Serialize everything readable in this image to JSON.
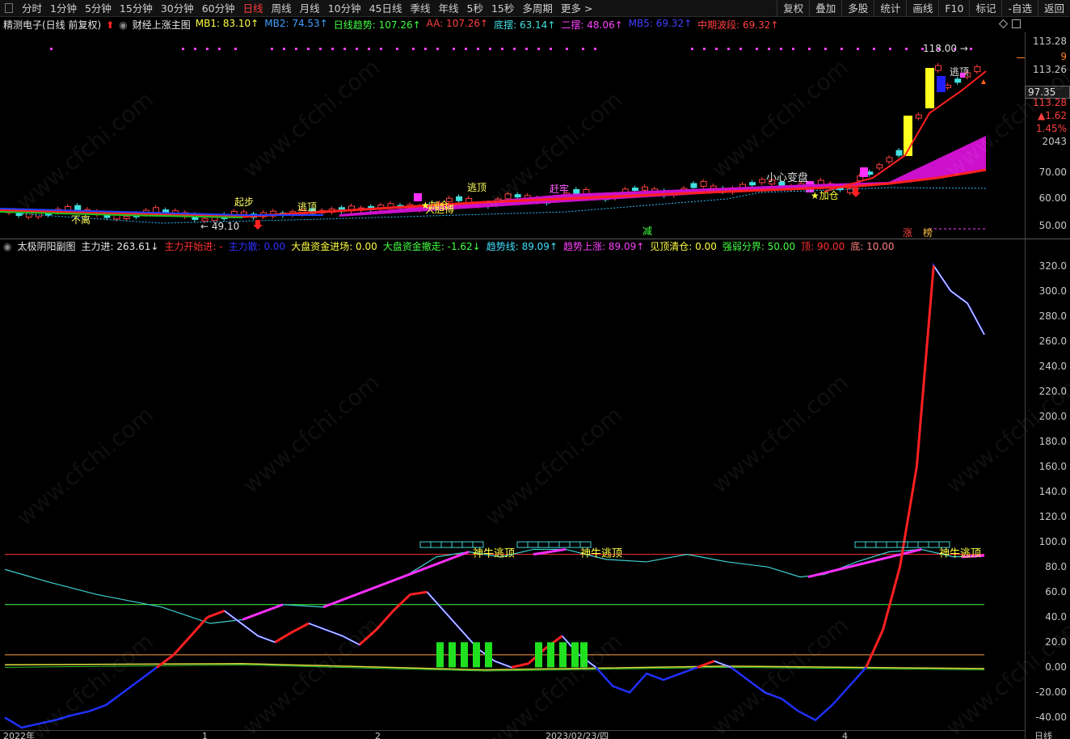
{
  "toolbar": {
    "items": [
      "分时",
      "1分钟",
      "5分钟",
      "15分钟",
      "30分钟",
      "60分钟",
      "日线",
      "周线",
      "月线",
      "10分钟",
      "45日线",
      "季线",
      "年线",
      "5秒",
      "15秒",
      "多周期",
      "更多 >"
    ],
    "active": "日线",
    "right_items": [
      "复权",
      "叠加",
      "多股",
      "统计",
      "画线",
      "F10",
      "标记",
      "-自选",
      "返回"
    ]
  },
  "main_header": {
    "stock": "精测电子(日线 前复权)",
    "indicator": "财经上涨主图",
    "fields": [
      {
        "label": "MB1: 83.10",
        "color": "#ffff40",
        "arrow": "↑"
      },
      {
        "label": "MB2: 74.53",
        "color": "#40a0ff",
        "arrow": "↑"
      },
      {
        "label": "日线趋势: 107.26",
        "color": "#40ff40",
        "arrow": "↑"
      },
      {
        "label": "AA: 107.26",
        "color": "#ff4040",
        "arrow": "↑"
      },
      {
        "label": "底摆: 63.14",
        "color": "#40e0e0",
        "arrow": "↑"
      },
      {
        "label": "二摆: 48.06",
        "color": "#ff40ff",
        "arrow": "↑"
      },
      {
        "label": "MB5: 69.32",
        "color": "#4040ff",
        "arrow": "↑"
      },
      {
        "label": "中期波段: 69.32",
        "color": "#ff4040",
        "arrow": "↑"
      }
    ]
  },
  "main_axis": {
    "labels": [
      "113.28",
      "9",
      "113.26",
      "113.28",
      "▲1.62",
      "1.45%",
      "2043",
      "70.00",
      "60.00",
      "50.00"
    ],
    "current_price": "97.35"
  },
  "main_annotations": {
    "high_mark": "118.00",
    "low_mark": "49.10",
    "signals": [
      "逃顶",
      "逃顶",
      "逃顶",
      "逃顶",
      "加仓",
      "加仓",
      "小心变盘",
      "加仓",
      "不离",
      "起步",
      "赶牢",
      "大胆博",
      "减",
      "涨",
      "榜"
    ]
  },
  "sub_header": {
    "indicator": "太极阴阳副图",
    "fields": [
      {
        "label": "主力进: 263.61",
        "color": "#e8e8e8",
        "arrow": "↓"
      },
      {
        "label": "主力开始进: -",
        "color": "#ff3030",
        "arrow": ""
      },
      {
        "label": "主力散: 0.00",
        "color": "#3030ff",
        "arrow": ""
      },
      {
        "label": "大盘资金进场: 0.00",
        "color": "#ffff40",
        "arrow": ""
      },
      {
        "label": "大盘资金撤走: -1.62",
        "color": "#40ff40",
        "arrow": "↓"
      },
      {
        "label": "趋势线: 89.09",
        "color": "#40e0ff",
        "arrow": "↑"
      },
      {
        "label": "趋势上涨: 89.09",
        "color": "#ff40ff",
        "arrow": "↑"
      },
      {
        "label": "见顶清仓: 0.00",
        "color": "#ffff40",
        "arrow": ""
      },
      {
        "label": "强弱分界: 50.00",
        "color": "#40ff40",
        "arrow": ""
      },
      {
        "label": "顶: 90.00",
        "color": "#ff3030",
        "arrow": ""
      },
      {
        "label": "底: 10.00",
        "color": "#ff8080",
        "arrow": ""
      }
    ]
  },
  "sub_axis": {
    "labels": [
      "320.0",
      "300.0",
      "280.0",
      "260.0",
      "240.0",
      "220.0",
      "200.0",
      "180.0",
      "160.0",
      "140.0",
      "120.0",
      "100.0",
      "80.0",
      "60.0",
      "40.0",
      "20.0",
      "0.00",
      "-20.00",
      "-40.00"
    ]
  },
  "sub_annotations": {
    "escape_label": "神牛逃顶"
  },
  "x_axis": {
    "labels": [
      "2022年",
      "1",
      "2",
      "2023/02/23/四",
      "4"
    ],
    "period": "日线"
  },
  "watermark": "www.cfchi.com",
  "chart_data": {
    "type": "line",
    "sub_chart": {
      "ylim": [
        -50,
        330
      ],
      "reference_lines": {
        "top": 90,
        "bottom": 10,
        "divide": 50,
        "zero": 0
      },
      "main_in_series": [
        -40,
        -48,
        -45,
        -42,
        -38,
        -35,
        -30,
        -20,
        -10,
        0,
        10,
        25,
        40,
        45,
        35,
        25,
        20,
        28,
        35,
        30,
        25,
        18,
        30,
        45,
        58,
        60,
        45,
        30,
        15,
        5,
        0,
        3,
        15,
        25,
        10,
        0,
        -15,
        -20,
        -5,
        -10,
        -5,
        0,
        5,
        0,
        -10,
        -20,
        -25,
        -35,
        -42,
        -30,
        -15,
        0,
        30,
        80,
        160,
        320,
        300,
        290,
        265
      ]
    }
  }
}
